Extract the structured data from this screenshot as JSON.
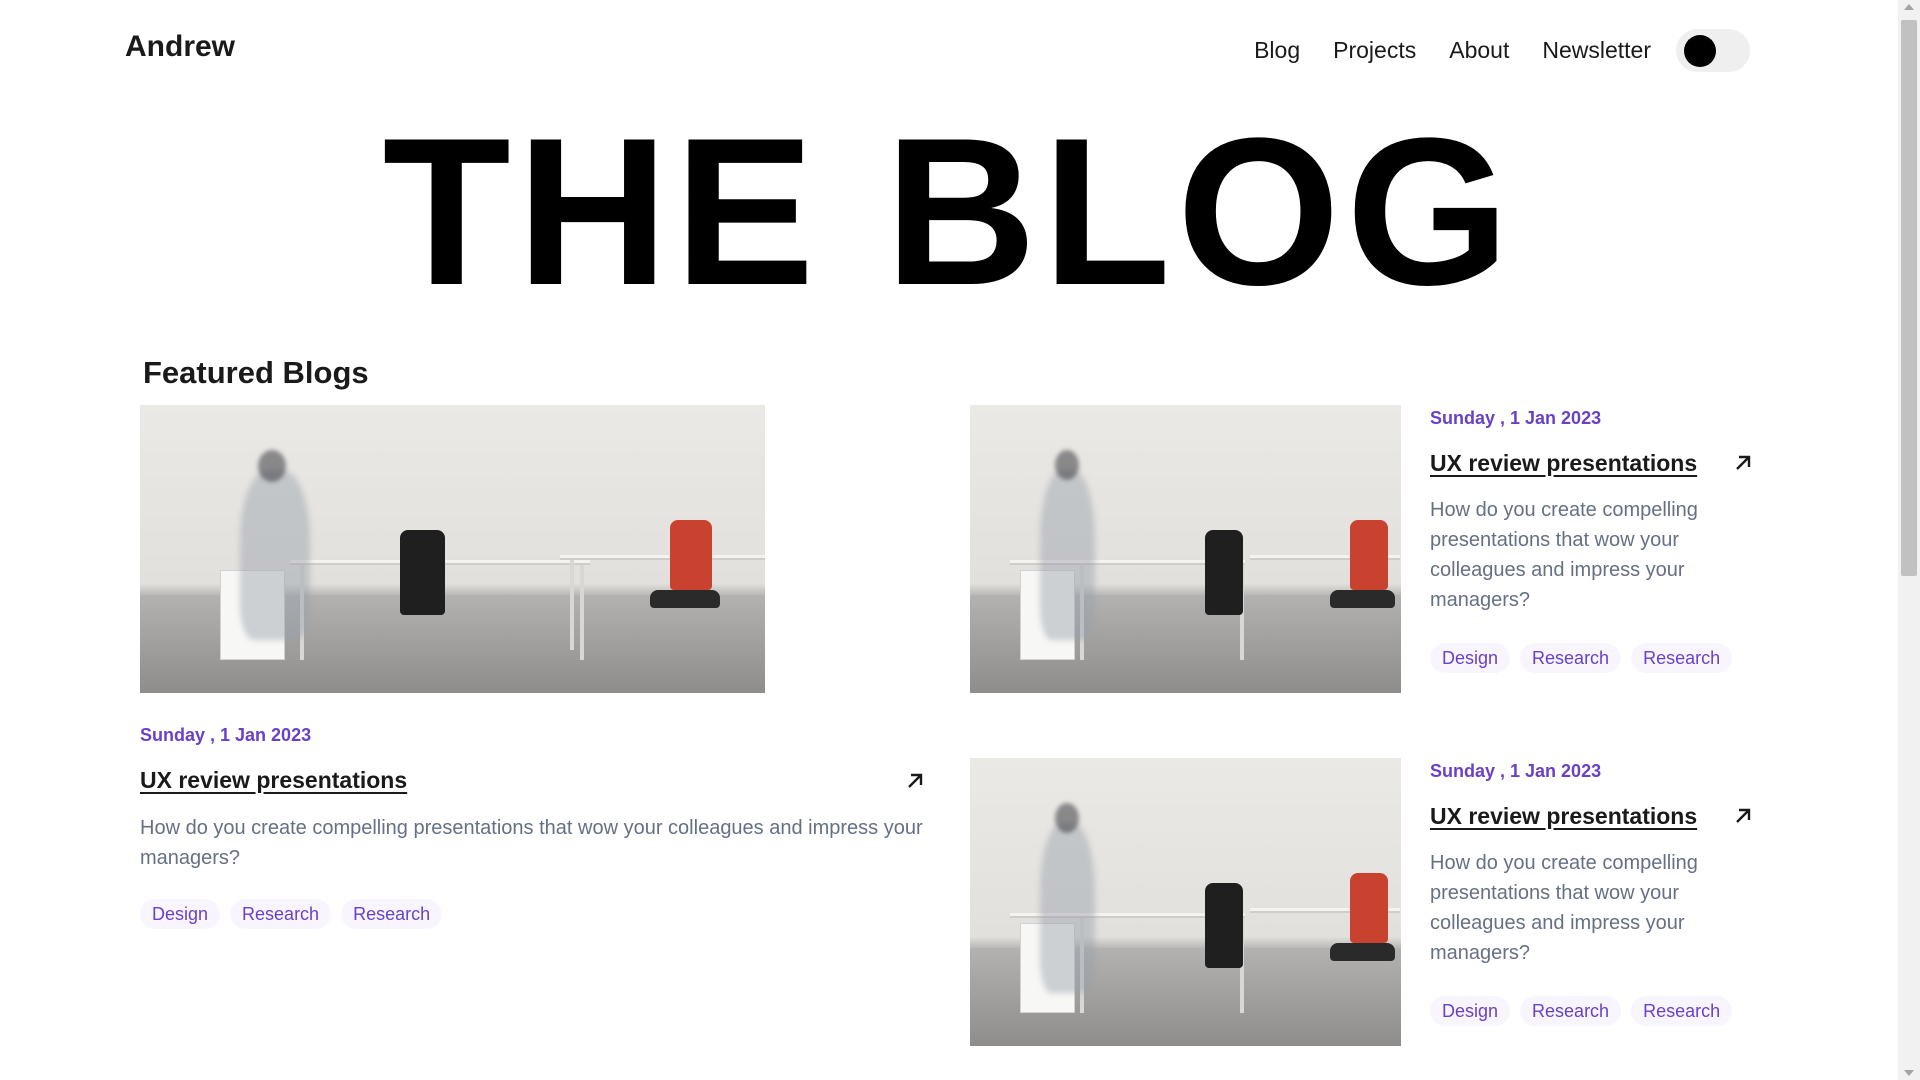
{
  "header": {
    "logo": "Andrew",
    "nav": [
      "Blog",
      "Projects",
      "About",
      "Newsletter"
    ],
    "theme_toggle": "dark-mode-toggle"
  },
  "hero": {
    "title": "THE BLOG"
  },
  "featured": {
    "title": "Featured Blogs",
    "posts": [
      {
        "date": "Sunday , 1 Jan 2023",
        "title": "UX review presentations",
        "excerpt": "How do you create compelling presentations that wow your colleagues and impress your managers?",
        "tags": [
          "Design",
          "Research",
          "Research"
        ],
        "image": "office-photo",
        "link_icon": "arrow-up-right-icon"
      },
      {
        "date": "Sunday , 1 Jan 2023",
        "title": "UX review presentations",
        "excerpt": "How do you create compelling presentations that wow your colleagues and impress your managers?",
        "tags": [
          "Design",
          "Research",
          "Research"
        ],
        "image": "office-photo",
        "link_icon": "arrow-up-right-icon"
      },
      {
        "date": "Sunday , 1 Jan 2023",
        "title": "UX review presentations",
        "excerpt": "How do you create compelling presentations that wow your colleagues and impress your managers?",
        "tags": [
          "Design",
          "Research",
          "Research"
        ],
        "image": "office-photo",
        "link_icon": "arrow-up-right-icon"
      }
    ]
  },
  "colors": {
    "accent": "#6941c6",
    "tag_bg": "#f9f5ff",
    "text": "#1a1a1a",
    "muted": "#667085"
  }
}
